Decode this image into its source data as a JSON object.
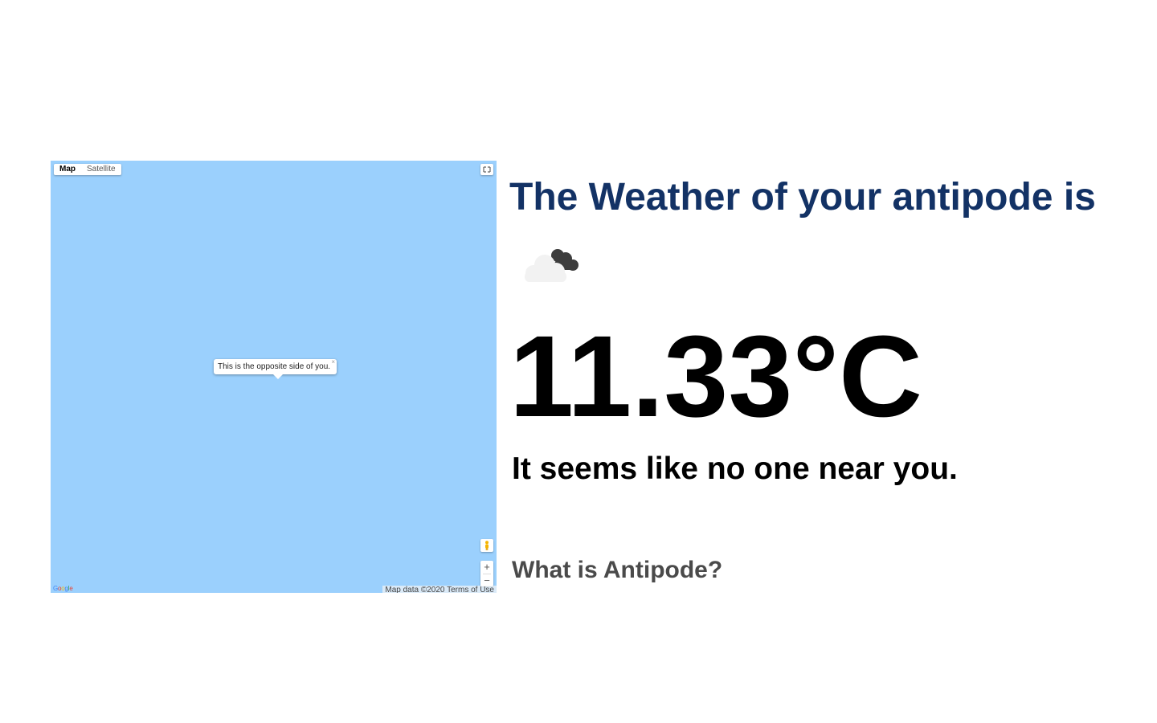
{
  "map": {
    "type_control": {
      "map_label": "Map",
      "satellite_label": "Satellite"
    },
    "fullscreen_icon": "fullscreen-icon",
    "infowindow": {
      "text": "This is the opposite side of you.",
      "close_label": "×"
    },
    "pegman_icon": "pegman-icon",
    "zoom": {
      "in_label": "+",
      "out_label": "−"
    },
    "logo_text": "Google",
    "attribution": {
      "data": "Map data ©2020",
      "terms": "Terms of Use"
    },
    "water_color": "#9bd0fd"
  },
  "weather": {
    "heading": "The Weather of your antipode is",
    "icon": "partly-cloudy-icon",
    "temperature": "11.33°C",
    "nearby_message": "It seems like no one near you.",
    "link_label": "What is Antipode?",
    "heading_color": "#133265"
  }
}
